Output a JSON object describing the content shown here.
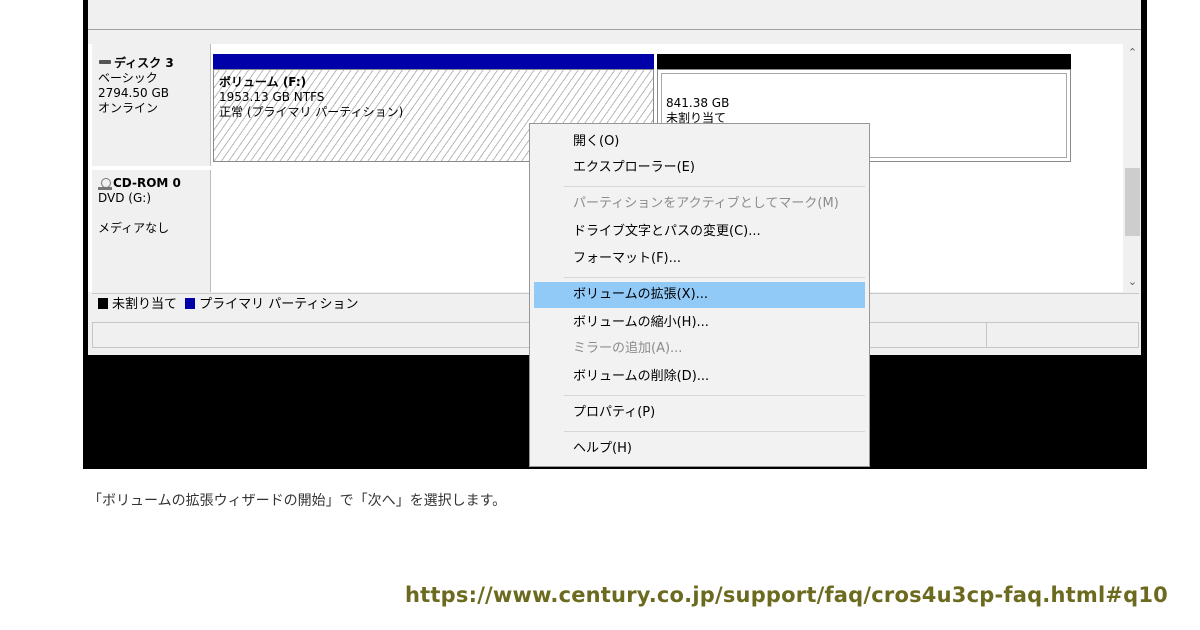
{
  "disks": [
    {
      "name": "ディスク 3",
      "type": "ベーシック",
      "size": "2794.50 GB",
      "status": "オンライン",
      "partitions": [
        {
          "label": "ボリューム (F:)",
          "size": "1953.13 GB NTFS",
          "status": "正常 (プライマリ パーティション)"
        },
        {
          "size": "841.38 GB",
          "status": "未割り当て"
        }
      ]
    },
    {
      "name": "CD-ROM 0",
      "type": "DVD (G:)",
      "status": "メディアなし"
    }
  ],
  "legend": [
    {
      "label": "未割り当て",
      "color": "#000000"
    },
    {
      "label": "プライマリ パーティション",
      "color": "#0000a8"
    }
  ],
  "context_menu": {
    "items": [
      {
        "label": "開く(O)",
        "enabled": true
      },
      {
        "label": "エクスプローラー(E)",
        "enabled": true
      },
      {
        "label": "パーティションをアクティブとしてマーク(M)",
        "enabled": false
      },
      {
        "label": "ドライブ文字とパスの変更(C)...",
        "enabled": true
      },
      {
        "label": "フォーマット(F)...",
        "enabled": true
      },
      {
        "label": "ボリュームの拡張(X)...",
        "enabled": true,
        "highlighted": true
      },
      {
        "label": "ボリュームの縮小(H)...",
        "enabled": true
      },
      {
        "label": "ミラーの追加(A)...",
        "enabled": false
      },
      {
        "label": "ボリュームの削除(D)...",
        "enabled": true
      },
      {
        "label": "プロパティ(P)",
        "enabled": true
      },
      {
        "label": "ヘルプ(H)",
        "enabled": true
      }
    ]
  },
  "caption": "「ボリュームの拡張ウィザードの開始」で「次へ」を選択します。",
  "source_url": "https://www.century.co.jp/support/faq/cros4u3cp-faq.html#q10",
  "colors": {
    "primary_partition": "#0000a8",
    "unallocated": "#000000",
    "menu_highlight": "#91c9f7",
    "url_text": "#6b6a1e"
  },
  "icons": {
    "disk": "hard-disk-icon",
    "cdrom": "cd-rom-icon",
    "scroll_up": "chevron-up-icon",
    "scroll_down": "chevron-down-icon"
  }
}
